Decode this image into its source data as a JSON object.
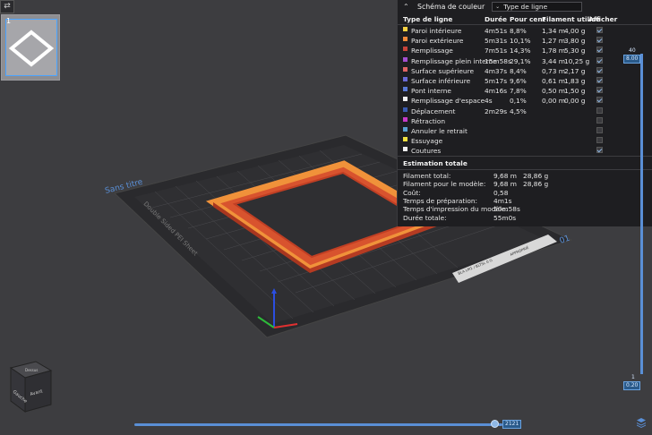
{
  "window": {
    "collapse_icon": "expand-arrows-icon"
  },
  "plates": [
    {
      "number": "1"
    }
  ],
  "legend": {
    "title": "Schéma de couleur",
    "view_mode_selected": "Type de ligne",
    "columns": {
      "type": "Type de ligne",
      "time": "Durée",
      "percent": "Pour cent",
      "filament": "Filament utilisé",
      "display": "Afficher"
    },
    "rows": [
      {
        "name": "Paroi intérieure",
        "color": "#f5d142",
        "time": "4m51s",
        "percent": "8,8%",
        "length": "1,34 m",
        "weight": "4,00 g",
        "checked": true
      },
      {
        "name": "Paroi extérieure",
        "color": "#f08a3a",
        "time": "5m31s",
        "percent": "10,1%",
        "length": "1,27 m",
        "weight": "3,80 g",
        "checked": true
      },
      {
        "name": "Remplissage",
        "color": "#c8443a",
        "time": "7m51s",
        "percent": "14,3%",
        "length": "1,78 m",
        "weight": "5,30 g",
        "checked": true
      },
      {
        "name": "Remplissage plein interne",
        "color": "#a24fd0",
        "time": "15m58s",
        "percent": "29,1%",
        "length": "3,44 m",
        "weight": "10,25 g",
        "checked": true
      },
      {
        "name": "Surface supérieure",
        "color": "#e06464",
        "time": "4m37s",
        "percent": "8,4%",
        "length": "0,73 m",
        "weight": "2,17 g",
        "checked": true
      },
      {
        "name": "Surface inférieure",
        "color": "#6a6ad6",
        "time": "5m17s",
        "percent": "9,6%",
        "length": "0,61 m",
        "weight": "1,83 g",
        "checked": true
      },
      {
        "name": "Pont interne",
        "color": "#5a7ad6",
        "time": "4m16s",
        "percent": "7,8%",
        "length": "0,50 m",
        "weight": "1,50 g",
        "checked": true
      },
      {
        "name": "Remplissage d'espace",
        "color": "#f0f0f0",
        "time": "4s",
        "percent": "0,1%",
        "length": "0,00 m",
        "weight": "0,00 g",
        "checked": true
      },
      {
        "name": "Déplacement",
        "color": "#3a5ab0",
        "time": "2m29s",
        "percent": "4,5%",
        "length": "",
        "weight": "",
        "checked": false
      },
      {
        "name": "Rétraction",
        "color": "#c83ac8",
        "time": "",
        "percent": "",
        "length": "",
        "weight": "",
        "checked": false
      },
      {
        "name": "Annuler le retrait",
        "color": "#5aa0d0",
        "time": "",
        "percent": "",
        "length": "",
        "weight": "",
        "checked": false
      },
      {
        "name": "Essuyage",
        "color": "#f0e040",
        "time": "",
        "percent": "",
        "length": "",
        "weight": "",
        "checked": false
      },
      {
        "name": "Coutures",
        "color": "#f0f0f0",
        "time": "",
        "percent": "",
        "length": "",
        "weight": "",
        "checked": true
      }
    ],
    "estimation": {
      "title": "Estimation totale",
      "rows": [
        {
          "label": "Filament total:",
          "a": "9,68 m",
          "b": "28,86 g"
        },
        {
          "label": "Filament pour le modèle:",
          "a": "9,68 m",
          "b": "28,86 g"
        },
        {
          "label": "Coût:",
          "a": "0,58",
          "b": ""
        },
        {
          "label": "Temps de préparation:",
          "a": "4m1s",
          "b": ""
        },
        {
          "label": "Temps d'impression du modèle:",
          "a": "50m58s",
          "b": ""
        },
        {
          "label": "Durée totale:",
          "a": "55m0s",
          "b": ""
        }
      ]
    }
  },
  "scene": {
    "plate_name": "Sans titre",
    "plate_label": "Double Sided PEI Sheet",
    "plate_number": "01",
    "tag_a": "BLA LM1 / BLTSL 0 G",
    "tag_b": "APPROPRIÉ",
    "view_cube": {
      "top": "Dessus",
      "left": "Gauche",
      "front": "Avant"
    }
  },
  "layer_slider": {
    "top_value": "40",
    "top_height": "8.00",
    "bottom_value": "1",
    "bottom_height": "0.20"
  },
  "move_slider": {
    "value": "2121"
  }
}
